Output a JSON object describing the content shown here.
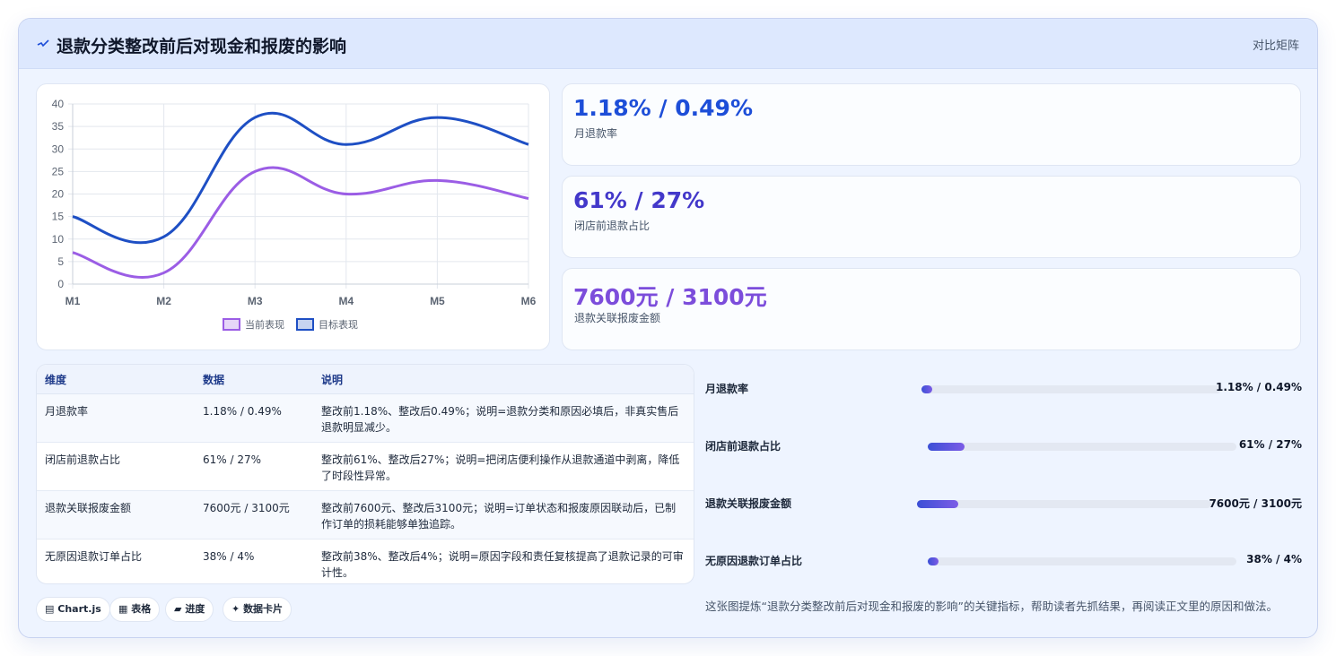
{
  "header": {
    "title": "退款分类整改前后对现金和报废的影响",
    "link": "对比矩阵"
  },
  "kpis": [
    {
      "value": "1.18% / 0.49%",
      "label": "月退款率",
      "color": "#1d4ed8"
    },
    {
      "value": "61% / 27%",
      "label": "闭店前退款占比",
      "color": "#4338ca"
    },
    {
      "value": "7600元 / 3100元",
      "label": "退款关联报废金额",
      "color": "#7c4ddb"
    }
  ],
  "table": {
    "headers": [
      "维度",
      "数据",
      "说明"
    ],
    "rows": [
      [
        "月退款率",
        "1.18% / 0.49%",
        "整改前1.18%、整改后0.49%；说明=退款分类和原因必填后，非真实售后退款明显减少。"
      ],
      [
        "闭店前退款占比",
        "61% / 27%",
        "整改前61%、整改后27%；说明=把闭店便利操作从退款通道中剥离，降低了时段性异常。"
      ],
      [
        "退款关联报废金额",
        "7600元 / 3100元",
        "整改前7600元、整改后3100元；说明=订单状态和报废原因联动后，已制作订单的损耗能够单独追踪。"
      ],
      [
        "无原因退款订单占比",
        "38% / 4%",
        "整改前38%、整改后4%；说明=原因字段和责任复核提高了退款记录的可审计性。"
      ]
    ]
  },
  "progress": [
    {
      "label": "月退款率",
      "value": "1.18% / 0.49%",
      "fraction": 0.035
    },
    {
      "label": "闭店前退款占比",
      "value": "61% / 27%",
      "fraction": 0.12
    },
    {
      "label": "退款关联报废金额",
      "value": "7600元 / 3100元",
      "fraction": 0.14
    },
    {
      "label": "无原因退款订单占比",
      "value": "38% / 4%",
      "fraction": 0.035
    }
  ],
  "chips": [
    {
      "icon": "▤",
      "label": "Chart.js"
    },
    {
      "icon": "▦",
      "label": "表格"
    },
    {
      "icon": "▰",
      "label": "进度"
    },
    {
      "icon": "✦",
      "label": "数据卡片"
    }
  ],
  "footnote": "这张图提炼“退款分类整改前后对现金和报废的影响”的关键指标，帮助读者先抓结果，再阅读正文里的原因和做法。",
  "chart_data": {
    "type": "line",
    "categories": [
      "M1",
      "M2",
      "M3",
      "M4",
      "M5",
      "M6"
    ],
    "ylim": [
      0,
      40
    ],
    "yticks": [
      0,
      5,
      10,
      15,
      20,
      25,
      30,
      35,
      40
    ],
    "grid": true,
    "legend_position": "bottom",
    "series": [
      {
        "name": "当前表现",
        "values": [
          7,
          2.5,
          25,
          20,
          23,
          19
        ],
        "color": "#9b5de5"
      },
      {
        "name": "目标表现",
        "values": [
          15,
          10.5,
          37,
          31,
          37,
          31
        ],
        "color": "#1e4fc4"
      }
    ]
  }
}
